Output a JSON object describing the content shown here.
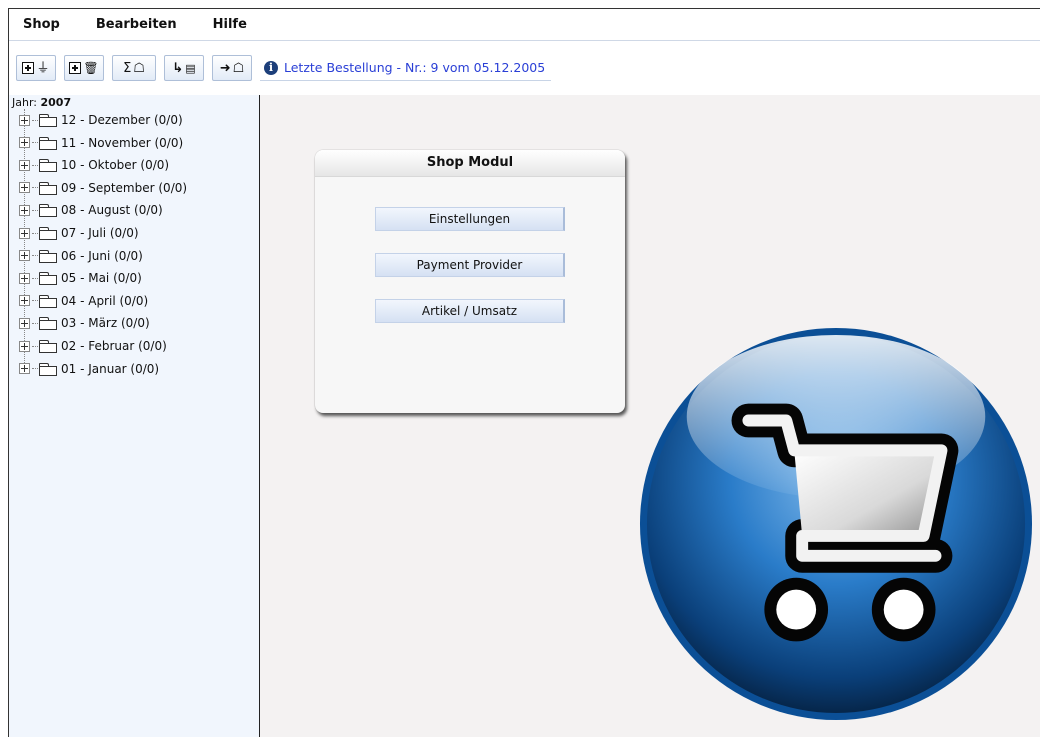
{
  "menu": [
    "Shop",
    "Bearbeiten",
    "Hilfe"
  ],
  "toolbar": {
    "info_text": "Letzte Bestellung - Nr.: 9 vom 05.12.2005"
  },
  "sidebar": {
    "year_prefix": "Jahr:",
    "year": "2007",
    "months": [
      "12 - Dezember (0/0)",
      "11 - November (0/0)",
      "10 - Oktober (0/0)",
      "09 - September (0/0)",
      "08 - August (0/0)",
      "07 - Juli (0/0)",
      "06 - Juni (0/0)",
      "05 - Mai (0/0)",
      "04 - April (0/0)",
      "03 - März (0/0)",
      "02 - Februar (0/0)",
      "01 - Januar (0/0)"
    ]
  },
  "panel": {
    "title": "Shop Modul",
    "buttons": [
      "Einstellungen",
      "Payment Provider",
      "Artikel / Umsatz"
    ]
  },
  "colors": {
    "accent_blue": "#1f6db8",
    "link_blue": "#2a3fd6",
    "sidebar_bg": "#f1f6fd"
  },
  "icons": {
    "logo": "shopping-cart-icon",
    "info": "info-icon"
  }
}
